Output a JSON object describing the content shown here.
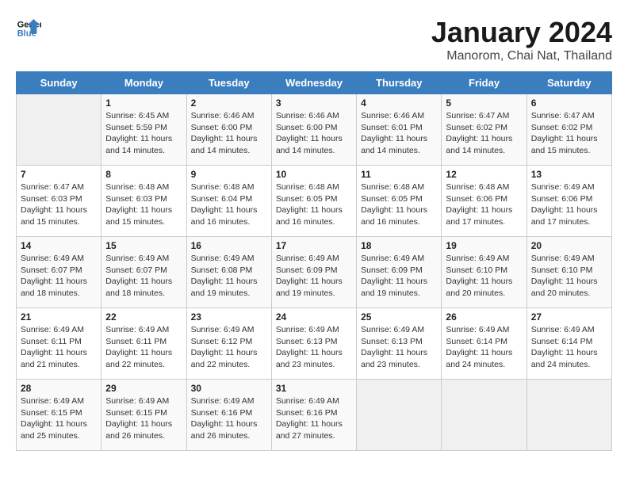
{
  "logo": {
    "line1": "General",
    "line2": "Blue"
  },
  "title": "January 2024",
  "subtitle": "Manorom, Chai Nat, Thailand",
  "weekdays": [
    "Sunday",
    "Monday",
    "Tuesday",
    "Wednesday",
    "Thursday",
    "Friday",
    "Saturday"
  ],
  "weeks": [
    [
      {
        "day": "",
        "info": ""
      },
      {
        "day": "1",
        "info": "Sunrise: 6:45 AM\nSunset: 5:59 PM\nDaylight: 11 hours\nand 14 minutes."
      },
      {
        "day": "2",
        "info": "Sunrise: 6:46 AM\nSunset: 6:00 PM\nDaylight: 11 hours\nand 14 minutes."
      },
      {
        "day": "3",
        "info": "Sunrise: 6:46 AM\nSunset: 6:00 PM\nDaylight: 11 hours\nand 14 minutes."
      },
      {
        "day": "4",
        "info": "Sunrise: 6:46 AM\nSunset: 6:01 PM\nDaylight: 11 hours\nand 14 minutes."
      },
      {
        "day": "5",
        "info": "Sunrise: 6:47 AM\nSunset: 6:02 PM\nDaylight: 11 hours\nand 14 minutes."
      },
      {
        "day": "6",
        "info": "Sunrise: 6:47 AM\nSunset: 6:02 PM\nDaylight: 11 hours\nand 15 minutes."
      }
    ],
    [
      {
        "day": "7",
        "info": "Sunrise: 6:47 AM\nSunset: 6:03 PM\nDaylight: 11 hours\nand 15 minutes."
      },
      {
        "day": "8",
        "info": "Sunrise: 6:48 AM\nSunset: 6:03 PM\nDaylight: 11 hours\nand 15 minutes."
      },
      {
        "day": "9",
        "info": "Sunrise: 6:48 AM\nSunset: 6:04 PM\nDaylight: 11 hours\nand 16 minutes."
      },
      {
        "day": "10",
        "info": "Sunrise: 6:48 AM\nSunset: 6:05 PM\nDaylight: 11 hours\nand 16 minutes."
      },
      {
        "day": "11",
        "info": "Sunrise: 6:48 AM\nSunset: 6:05 PM\nDaylight: 11 hours\nand 16 minutes."
      },
      {
        "day": "12",
        "info": "Sunrise: 6:48 AM\nSunset: 6:06 PM\nDaylight: 11 hours\nand 17 minutes."
      },
      {
        "day": "13",
        "info": "Sunrise: 6:49 AM\nSunset: 6:06 PM\nDaylight: 11 hours\nand 17 minutes."
      }
    ],
    [
      {
        "day": "14",
        "info": "Sunrise: 6:49 AM\nSunset: 6:07 PM\nDaylight: 11 hours\nand 18 minutes."
      },
      {
        "day": "15",
        "info": "Sunrise: 6:49 AM\nSunset: 6:07 PM\nDaylight: 11 hours\nand 18 minutes."
      },
      {
        "day": "16",
        "info": "Sunrise: 6:49 AM\nSunset: 6:08 PM\nDaylight: 11 hours\nand 19 minutes."
      },
      {
        "day": "17",
        "info": "Sunrise: 6:49 AM\nSunset: 6:09 PM\nDaylight: 11 hours\nand 19 minutes."
      },
      {
        "day": "18",
        "info": "Sunrise: 6:49 AM\nSunset: 6:09 PM\nDaylight: 11 hours\nand 19 minutes."
      },
      {
        "day": "19",
        "info": "Sunrise: 6:49 AM\nSunset: 6:10 PM\nDaylight: 11 hours\nand 20 minutes."
      },
      {
        "day": "20",
        "info": "Sunrise: 6:49 AM\nSunset: 6:10 PM\nDaylight: 11 hours\nand 20 minutes."
      }
    ],
    [
      {
        "day": "21",
        "info": "Sunrise: 6:49 AM\nSunset: 6:11 PM\nDaylight: 11 hours\nand 21 minutes."
      },
      {
        "day": "22",
        "info": "Sunrise: 6:49 AM\nSunset: 6:11 PM\nDaylight: 11 hours\nand 22 minutes."
      },
      {
        "day": "23",
        "info": "Sunrise: 6:49 AM\nSunset: 6:12 PM\nDaylight: 11 hours\nand 22 minutes."
      },
      {
        "day": "24",
        "info": "Sunrise: 6:49 AM\nSunset: 6:13 PM\nDaylight: 11 hours\nand 23 minutes."
      },
      {
        "day": "25",
        "info": "Sunrise: 6:49 AM\nSunset: 6:13 PM\nDaylight: 11 hours\nand 23 minutes."
      },
      {
        "day": "26",
        "info": "Sunrise: 6:49 AM\nSunset: 6:14 PM\nDaylight: 11 hours\nand 24 minutes."
      },
      {
        "day": "27",
        "info": "Sunrise: 6:49 AM\nSunset: 6:14 PM\nDaylight: 11 hours\nand 24 minutes."
      }
    ],
    [
      {
        "day": "28",
        "info": "Sunrise: 6:49 AM\nSunset: 6:15 PM\nDaylight: 11 hours\nand 25 minutes."
      },
      {
        "day": "29",
        "info": "Sunrise: 6:49 AM\nSunset: 6:15 PM\nDaylight: 11 hours\nand 26 minutes."
      },
      {
        "day": "30",
        "info": "Sunrise: 6:49 AM\nSunset: 6:16 PM\nDaylight: 11 hours\nand 26 minutes."
      },
      {
        "day": "31",
        "info": "Sunrise: 6:49 AM\nSunset: 6:16 PM\nDaylight: 11 hours\nand 27 minutes."
      },
      {
        "day": "",
        "info": ""
      },
      {
        "day": "",
        "info": ""
      },
      {
        "day": "",
        "info": ""
      }
    ]
  ]
}
